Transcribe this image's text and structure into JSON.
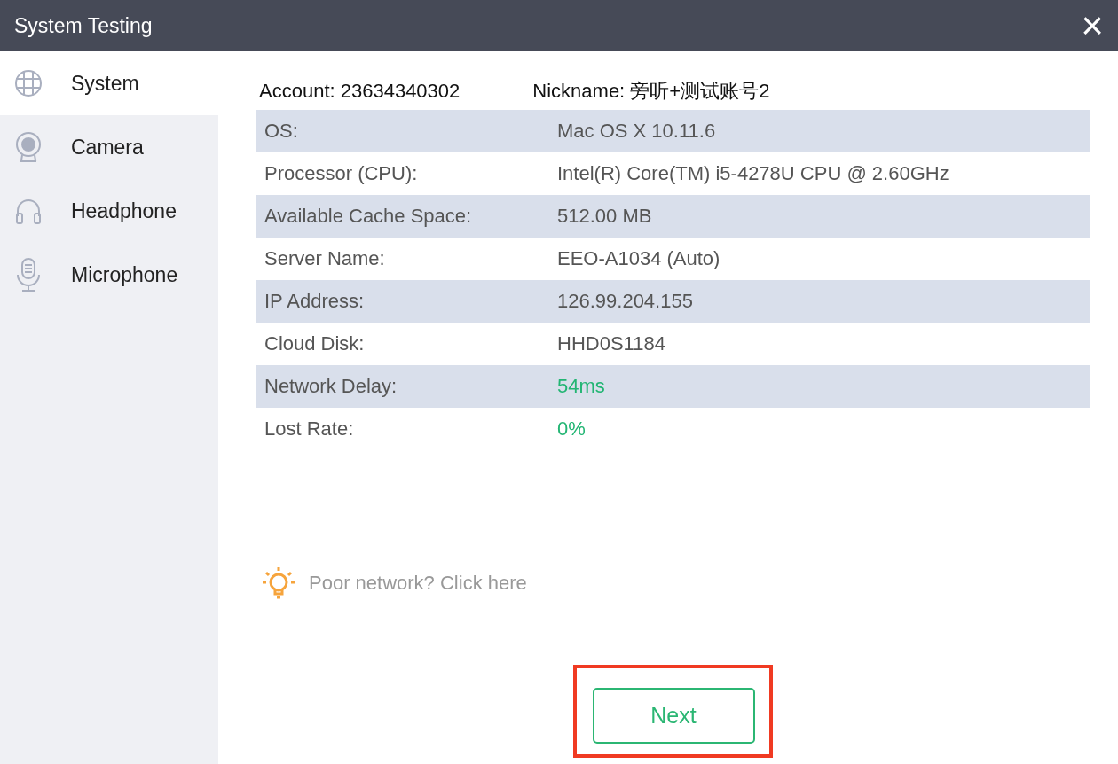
{
  "window": {
    "title": "System Testing",
    "close": "×"
  },
  "sidebar": {
    "items": [
      {
        "label": "System",
        "kind": "globe",
        "selected": true
      },
      {
        "label": "Camera",
        "kind": "camera",
        "selected": false
      },
      {
        "label": "Headphone",
        "kind": "headphone",
        "selected": false
      },
      {
        "label": "Microphone",
        "kind": "microphone",
        "selected": false
      }
    ]
  },
  "account": {
    "account": "Account: 23634340302",
    "nickname": "Nickname: 旁听+测试账号2"
  },
  "table": {
    "rows": [
      {
        "label": "OS:",
        "value": "Mac OS X 10.11.6"
      },
      {
        "label": "Processor (CPU):",
        "value": "Intel(R) Core(TM) i5-4278U CPU @ 2.60GHz"
      },
      {
        "label": "Available Cache Space:",
        "value": "512.00 MB"
      },
      {
        "label": "Server Name:",
        "value": "EEO-A1034 (Auto)"
      },
      {
        "label": "IP Address:",
        "value": "126.99.204.155"
      },
      {
        "label": "Cloud Disk:",
        "value": "HHD0S1184"
      },
      {
        "label": "Network Delay:",
        "value": "54ms",
        "color": "#22b573"
      },
      {
        "label": "Lost Rate:",
        "value": "0%",
        "color": "#22b573"
      }
    ]
  },
  "help_link": "Poor network? Click here",
  "buttons": [
    {
      "label": "Next",
      "highlighted": true
    }
  ]
}
